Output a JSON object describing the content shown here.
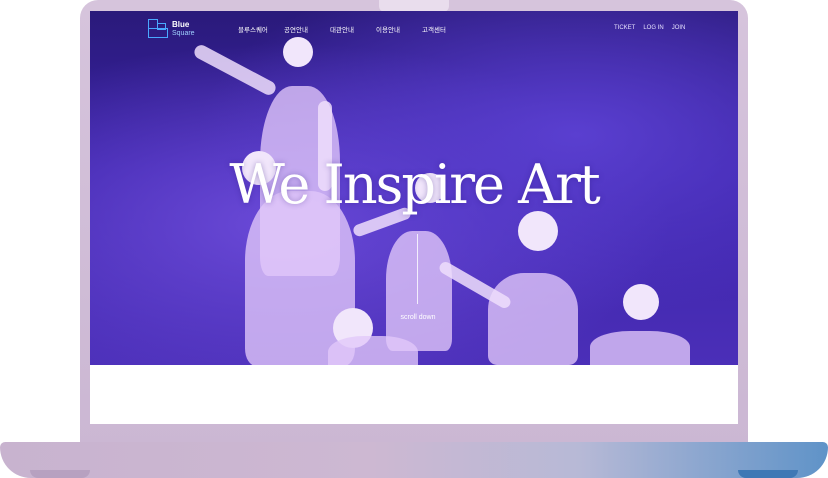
{
  "nav": {
    "logo_top": "Blue",
    "logo_bottom": "Square",
    "menu": [
      "블루스퀘어",
      "공연안내",
      "대관안내",
      "이용안내",
      "고객센터"
    ],
    "utility": [
      "TICKET",
      "LOG IN",
      "JOIN"
    ]
  },
  "hero": {
    "headline": "We Inspire Art",
    "scroll_label": "scroll down"
  },
  "colors": {
    "hero_bg": "#3a22a8",
    "logo_accent": "#4aa8ff",
    "laptop_body": "#cbb7d3",
    "laptop_base_accent": "#5f93c8"
  }
}
